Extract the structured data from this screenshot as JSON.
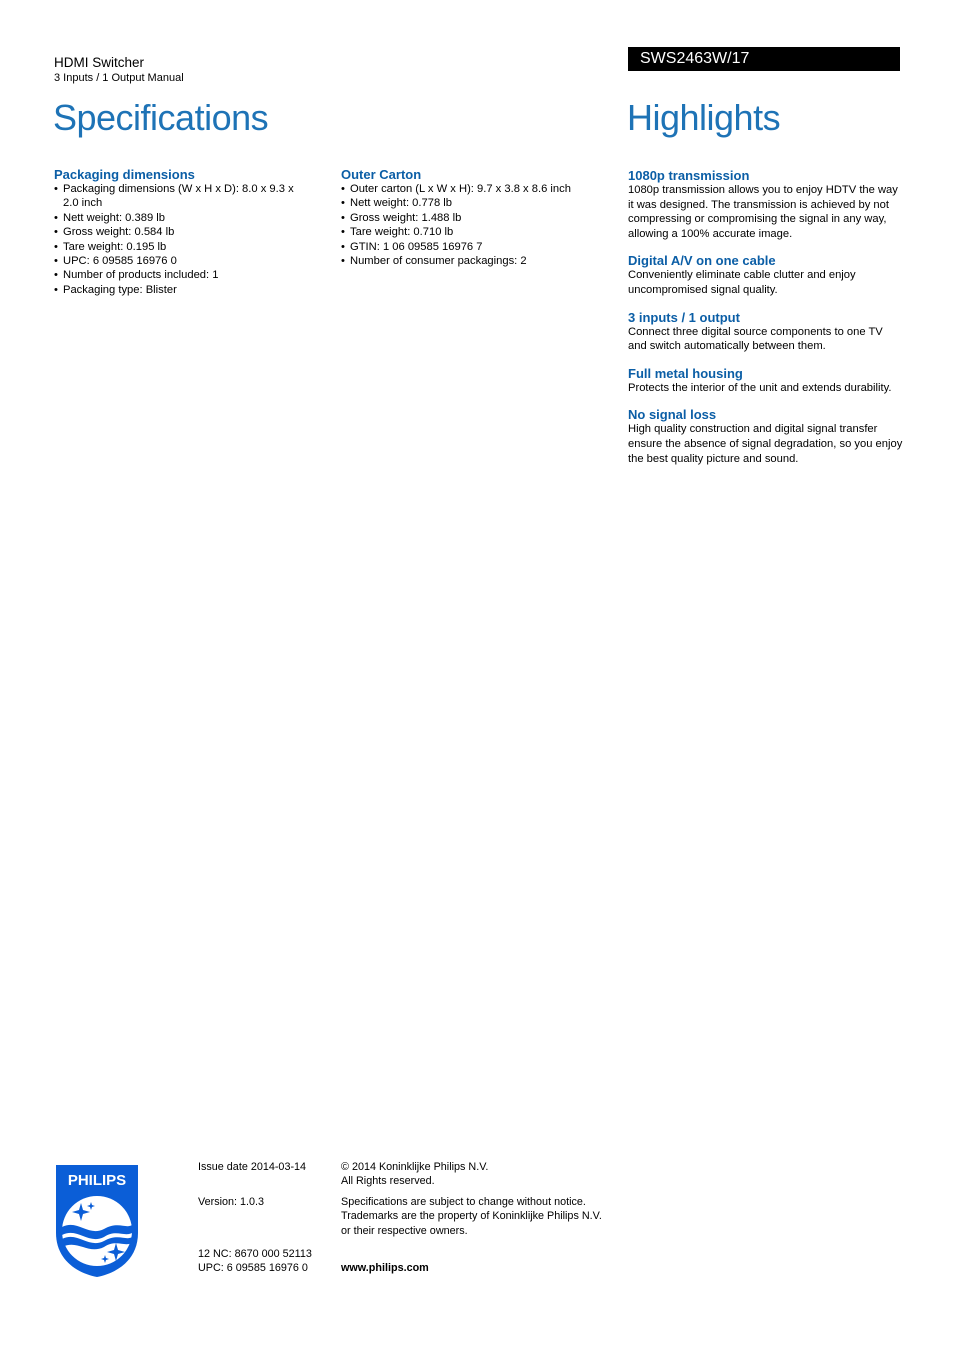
{
  "header": {
    "product_name": "HDMI Switcher",
    "product_subtitle": "3 Inputs / 1 Output Manual",
    "model_number": "SWS2463W/17"
  },
  "specifications": {
    "title": "Specifications",
    "sections": [
      {
        "heading": "Packaging dimensions",
        "items": [
          "Packaging dimensions (W x H x D): 8.0 x 9.3 x 2.0 inch",
          "Nett weight: 0.389 lb",
          "Gross weight: 0.584 lb",
          "Tare weight: 0.195 lb",
          "UPC: 6 09585 16976 0",
          "Number of products included: 1",
          "Packaging type: Blister"
        ]
      },
      {
        "heading": "Outer Carton",
        "items": [
          "Outer carton (L x W x H): 9.7 x 3.8 x 8.6 inch",
          "Nett weight: 0.778 lb",
          "Gross weight: 1.488 lb",
          "Tare weight: 0.710 lb",
          "GTIN: 1 06 09585 16976 7",
          "Number of consumer packagings: 2"
        ]
      }
    ]
  },
  "highlights": {
    "title": "Highlights",
    "items": [
      {
        "heading": "1080p transmission",
        "text": "1080p transmission allows you to enjoy HDTV the way it was designed. The transmission is achieved by not compressing or compromising the signal in any way, allowing a 100% accurate image."
      },
      {
        "heading": "Digital A/V on one cable",
        "text": "Conveniently eliminate cable clutter and enjoy uncompromised signal quality."
      },
      {
        "heading": "3 inputs / 1 output",
        "text": "Connect three digital source components to one TV and switch automatically between them."
      },
      {
        "heading": "Full metal housing",
        "text": "Protects the interior of the unit and extends durability."
      },
      {
        "heading": "No signal loss",
        "text": "High quality construction and digital signal transfer ensure the absence of signal degradation, so you enjoy the best quality picture and sound."
      }
    ]
  },
  "footer": {
    "logo_text": "PHILIPS",
    "issue_date": "Issue date 2014-03-14",
    "version": "Version: 1.0.3",
    "nc": "12 NC: 8670 000 52113",
    "upc": "UPC: 6 09585 16976 0",
    "copyright": "© 2014 Koninklijke Philips N.V.",
    "rights": "All Rights reserved.",
    "disclaimer_1": "Specifications are subject to change without notice.",
    "disclaimer_2": "Trademarks are the property of Koninklijke Philips N.V.",
    "disclaimer_3": "or their respective owners.",
    "website": "www.philips.com"
  },
  "colors": {
    "title_blue": "#1e73b6",
    "heading_blue": "#0b5ea6",
    "logo_blue": "#0b5ed7"
  }
}
